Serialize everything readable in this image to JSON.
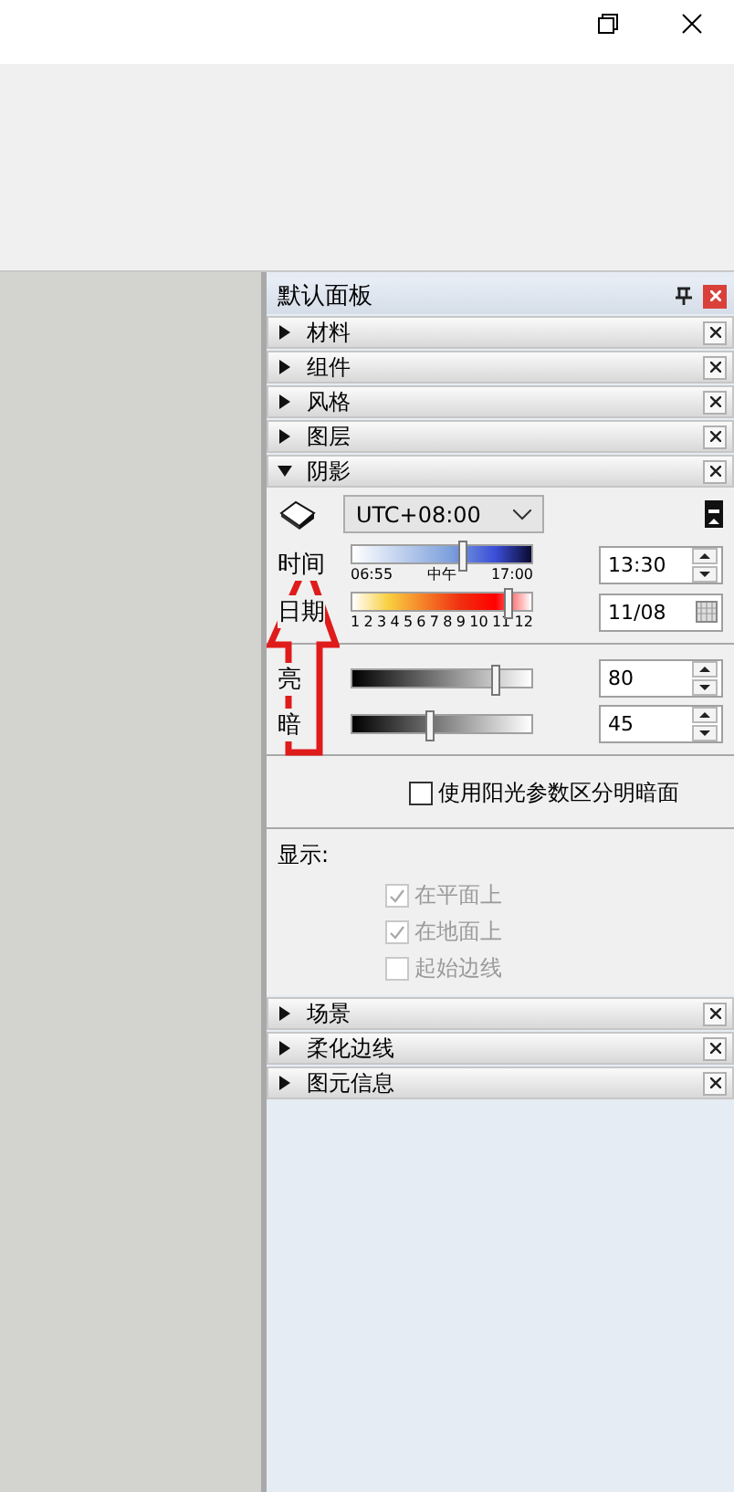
{
  "panel": {
    "title": "默认面板",
    "sections_before": [
      {
        "label": "材料",
        "expanded": false
      },
      {
        "label": "组件",
        "expanded": false
      },
      {
        "label": "风格",
        "expanded": false
      },
      {
        "label": "图层",
        "expanded": false
      },
      {
        "label": "阴影",
        "expanded": true
      }
    ],
    "shadow": {
      "timezone": "UTC+08:00",
      "time": {
        "label": "时间",
        "level": 0.61,
        "ticks": [
          "06:55",
          "中午",
          "17:00"
        ],
        "value": "13:30"
      },
      "date": {
        "label": "日期",
        "level": 0.87,
        "ticks": [
          "1",
          "2",
          "3",
          "4",
          "5",
          "6",
          "7",
          "8",
          "9",
          "10",
          "11",
          "12"
        ],
        "value": "11/08"
      },
      "light": {
        "label": "亮",
        "level": 0.8,
        "value": "80"
      },
      "dark": {
        "label": "暗",
        "level": 0.43,
        "value": "45"
      },
      "sun_shading": {
        "label": "使用阳光参数区分明暗面",
        "checked": false
      },
      "display_label": "显示:",
      "display": [
        {
          "label": "在平面上",
          "checked": true,
          "disabled": true
        },
        {
          "label": "在地面上",
          "checked": true,
          "disabled": true
        },
        {
          "label": "起始边线",
          "checked": false,
          "disabled": true
        }
      ]
    },
    "sections_after": [
      {
        "label": "场景",
        "expanded": false
      },
      {
        "label": "柔化边线",
        "expanded": false
      },
      {
        "label": "图元信息",
        "expanded": false
      }
    ]
  },
  "annotation": {
    "kind": "arrow"
  }
}
